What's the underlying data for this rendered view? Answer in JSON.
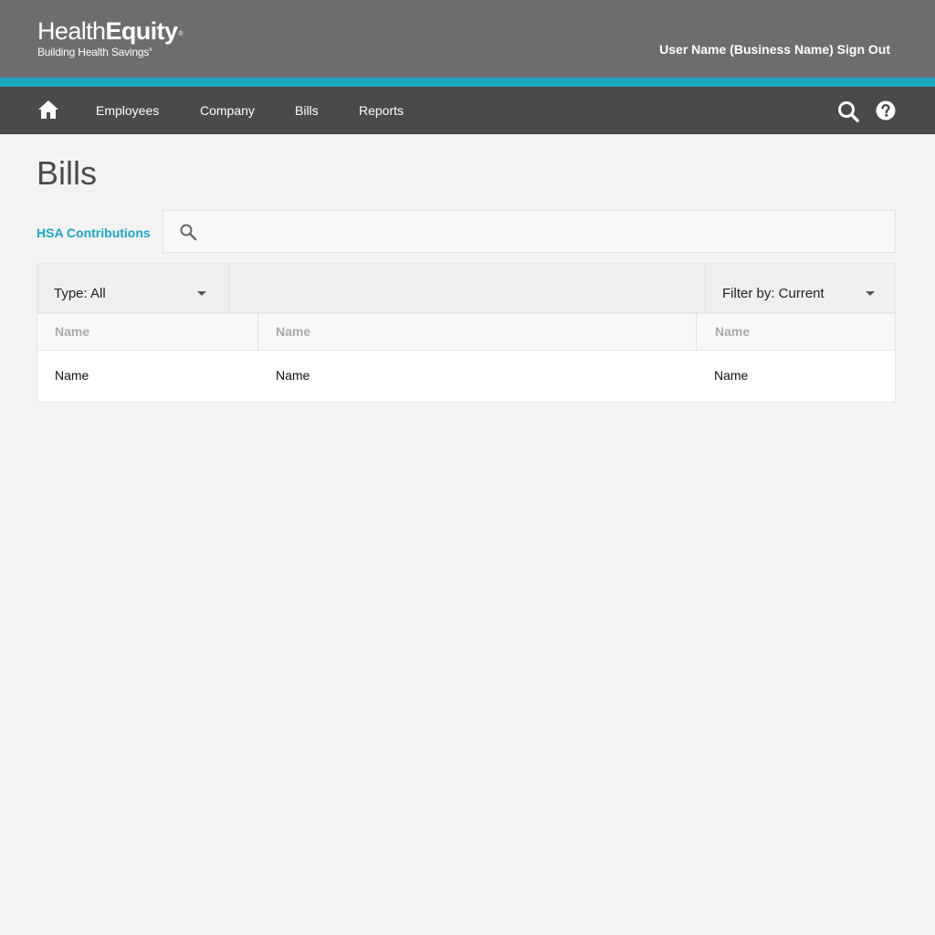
{
  "brand": {
    "name_light": "Health",
    "name_bold": "Equity",
    "registered": "®",
    "tagline": "Building Health Savings",
    "tagline_mark": "®"
  },
  "header": {
    "user_label": "User Name (Business Name)",
    "sign_out_label": "Sign Out"
  },
  "nav": {
    "home_icon": "home-icon",
    "items": [
      {
        "label": "Employees"
      },
      {
        "label": "Company"
      },
      {
        "label": "Bills"
      },
      {
        "label": "Reports"
      }
    ],
    "search_icon": "search-icon",
    "help_icon": "help-icon"
  },
  "page": {
    "title": "Bills",
    "side_link": "HSA Contributions"
  },
  "search": {
    "value": "",
    "placeholder": ""
  },
  "filters": {
    "type_label": "Type: All",
    "filter_label": "Filter by: Current"
  },
  "table": {
    "headers": [
      "Name",
      "Name",
      "Name"
    ],
    "rows": [
      [
        "Name",
        "Name",
        "Name"
      ]
    ]
  },
  "colors": {
    "header_bg": "#6c6d6f",
    "accent": "#1ea5c1",
    "nav_bg": "#4a4a4b",
    "page_bg": "#f3f3f3"
  }
}
